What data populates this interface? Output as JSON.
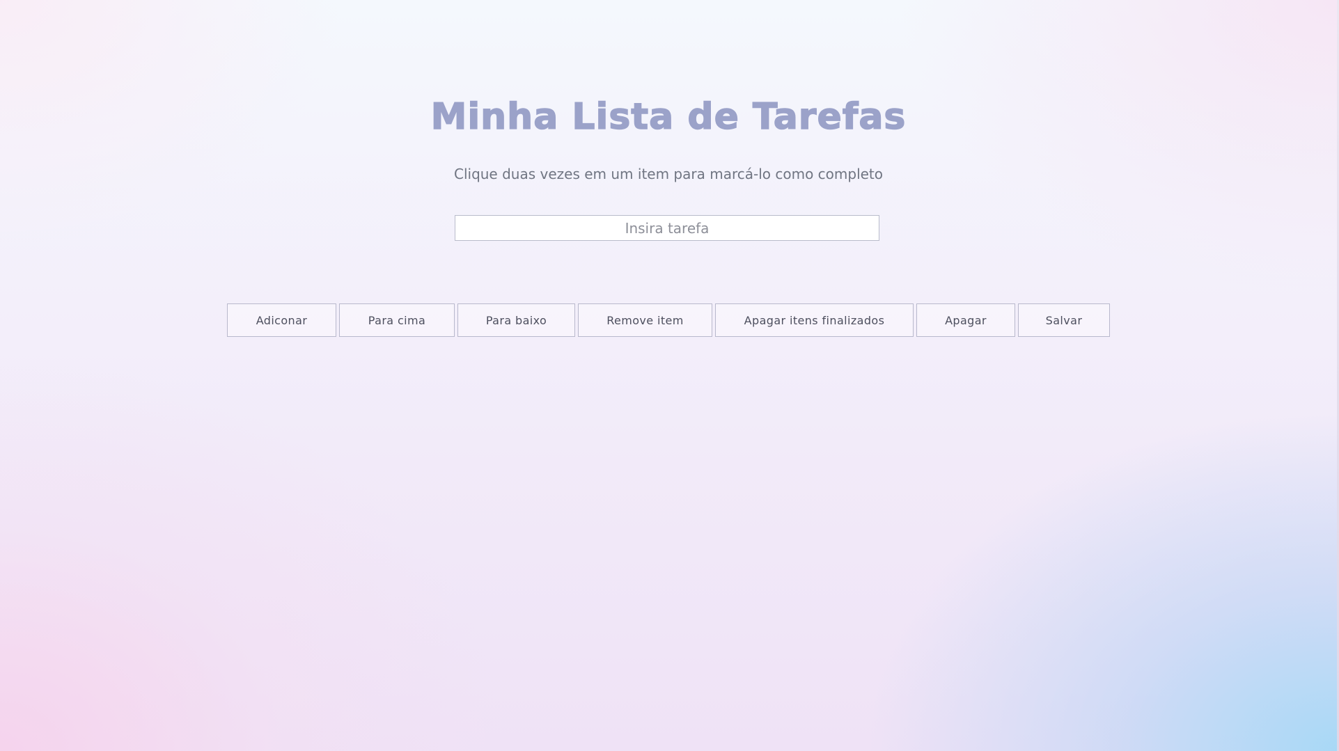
{
  "header": {
    "title": "Minha Lista de Tarefas",
    "subtitle": "Clique duas vezes em um item para marcá-lo como completo"
  },
  "task_input": {
    "value": "",
    "placeholder": "Insira tarefa"
  },
  "toolbar": {
    "add_label": "Adiconar",
    "up_label": "Para cima",
    "down_label": "Para baixo",
    "remove_label": "Remove item",
    "clear_done_label": "Apagar itens finalizados",
    "clear_label": "Apagar",
    "save_label": "Salvar"
  },
  "task_list": {
    "items": []
  },
  "colors": {
    "title": "#9ba2c9",
    "subtitle": "#707582",
    "button_text": "#4d4f5e",
    "button_border": "#b8b8cc",
    "background_top": "#f4f8fd",
    "background_bottom_right": "#a4d8f6",
    "background_bottom_left": "#f6d2ec"
  }
}
